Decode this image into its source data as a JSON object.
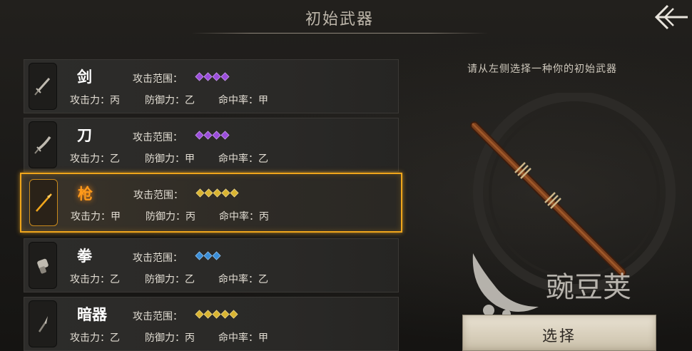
{
  "header": {
    "title": "初始武器"
  },
  "hint": "请从左侧选择一种你的初始武器",
  "select_button": {
    "label": "选择"
  },
  "watermark": {
    "text": "豌豆荚"
  },
  "colors": {
    "accent": "#f0a61c",
    "gem_purple": "#9b4ddb",
    "gem_gold": "#d9b431",
    "gem_blue": "#3a8ed8"
  },
  "weapons": [
    {
      "name": "剑",
      "icon": "sword-icon",
      "range_label": "攻击范围：",
      "range": 4,
      "gem_color": "#9b4ddb",
      "attack": "攻击力：丙",
      "defense": "防御力：乙",
      "accuracy": "命中率：甲"
    },
    {
      "name": "刀",
      "icon": "saber-icon",
      "range_label": "攻击范围：",
      "range": 4,
      "gem_color": "#9b4ddb",
      "attack": "攻击力：乙",
      "defense": "防御力：甲",
      "accuracy": "命中率：乙"
    },
    {
      "name": "枪",
      "icon": "spear-icon",
      "range_label": "攻击范围：",
      "range": 5,
      "gem_color": "#d9b431",
      "attack": "攻击力：甲",
      "defense": "防御力：丙",
      "accuracy": "命中率：丙",
      "selected": true
    },
    {
      "name": "拳",
      "icon": "fist-icon",
      "range_label": "攻击范围：",
      "range": 3,
      "gem_color": "#3a8ed8",
      "attack": "攻击力：乙",
      "defense": "防御力：乙",
      "accuracy": "命中率：乙"
    },
    {
      "name": "暗器",
      "icon": "dart-icon",
      "range_label": "攻击范围：",
      "range": 5,
      "gem_color": "#d9b431",
      "attack": "攻击力：乙",
      "defense": "防御力：丙",
      "accuracy": "命中率：甲"
    }
  ]
}
